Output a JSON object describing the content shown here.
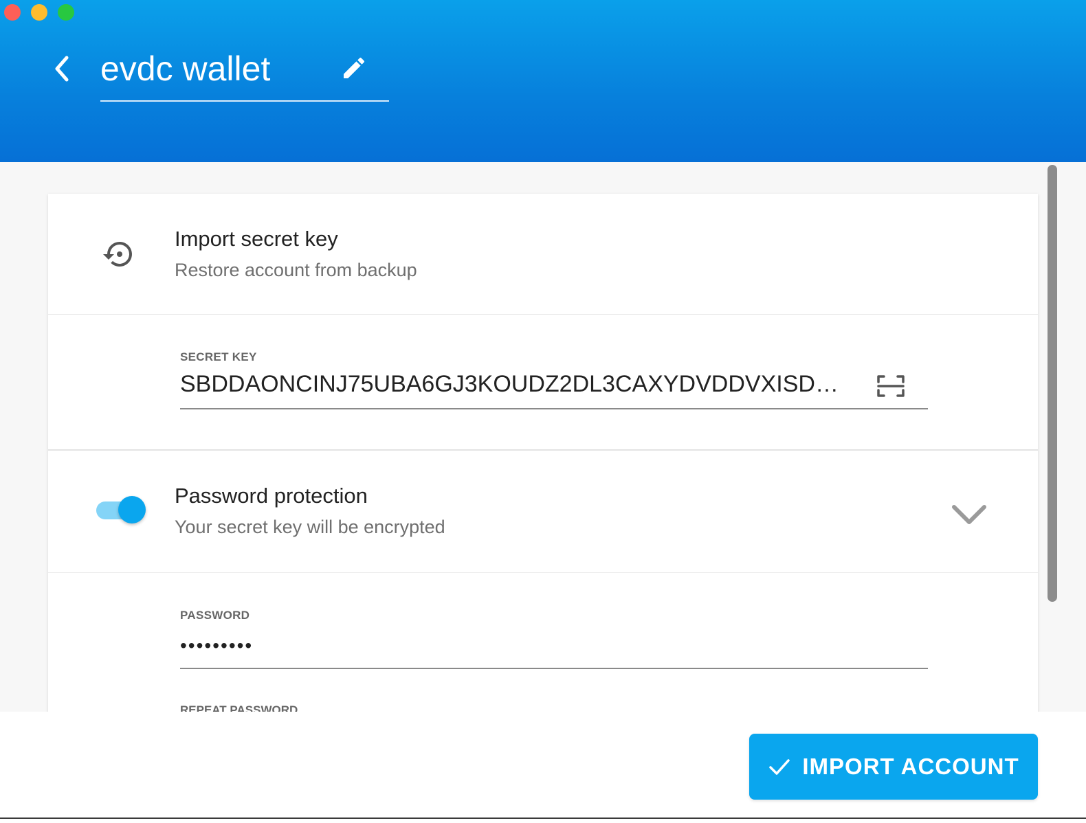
{
  "window": {
    "controls": [
      "close",
      "minimize",
      "maximize"
    ]
  },
  "header": {
    "title": "evdc wallet",
    "back_icon": "chevron-left-icon",
    "edit_icon": "pencil-icon",
    "gradient_colors": [
      "#0aa0ea",
      "#0670d6"
    ]
  },
  "import_section": {
    "icon": "restore-icon",
    "title": "Import secret key",
    "subtitle": "Restore account from backup"
  },
  "secret_key_field": {
    "label": "SECRET KEY",
    "value": "SBDDAONCINJ75UBA6GJ3KOUDZ2DL3CAXYDVDDVXISDKY...",
    "scan_icon": "qr-scan-icon"
  },
  "password_section": {
    "title": "Password protection",
    "subtitle": "Your secret key will be encrypted",
    "toggle_on": true,
    "expand_icon": "chevron-down-icon"
  },
  "password_field": {
    "label": "PASSWORD",
    "value": "•••••••••",
    "repeat_label": "REPEAT PASSWORD"
  },
  "footer": {
    "import_button_label": "IMPORT ACCOUNT",
    "import_button_icon": "check-icon",
    "accent_color": "#0aa6ee"
  }
}
